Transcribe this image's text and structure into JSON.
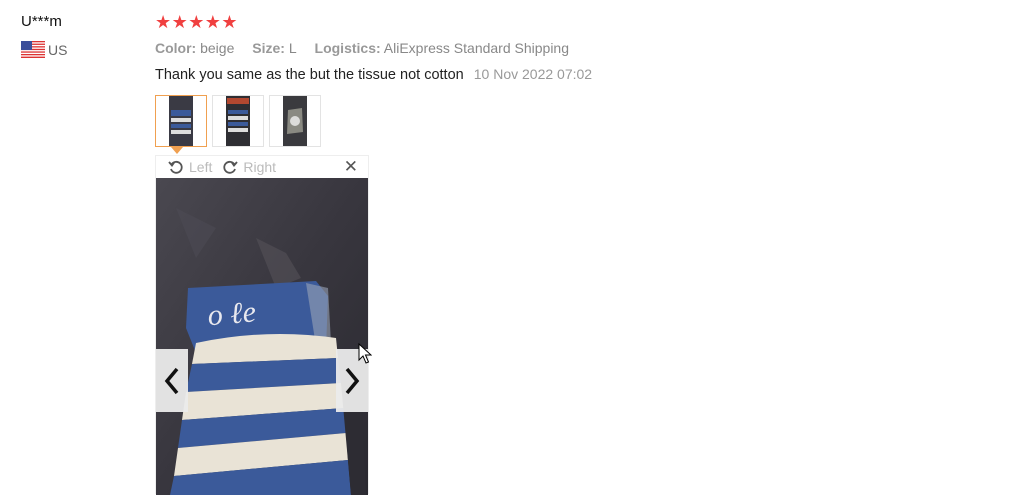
{
  "reviewer": {
    "name": "U***m",
    "country_code": "US",
    "flag_icon": "us-flag-icon"
  },
  "rating": {
    "value": 5,
    "max": 5,
    "star_color": "#f04040"
  },
  "attributes": {
    "color_key": "Color:",
    "color_value": "beige",
    "size_key": "Size:",
    "size_value": "L",
    "logistics_key": "Logistics:",
    "logistics_value": "AliExpress Standard Shipping"
  },
  "review": {
    "text": "Thank you same as the but the tissue not cotton",
    "date": "10 Nov 2022 07:02"
  },
  "thumbnails": [
    {
      "name": "review-photo-1",
      "active": true
    },
    {
      "name": "review-photo-2",
      "active": false
    },
    {
      "name": "review-photo-3",
      "active": false
    }
  ],
  "viewer": {
    "rotate_left_label": "Left",
    "rotate_right_label": "Right",
    "close_icon": "close-icon",
    "prev_icon": "chevron-left-icon",
    "next_icon": "chevron-right-icon"
  },
  "colors": {
    "accent": "#f0a050",
    "muted_text": "#999999",
    "stripe_blue": "#3b5a9a"
  }
}
